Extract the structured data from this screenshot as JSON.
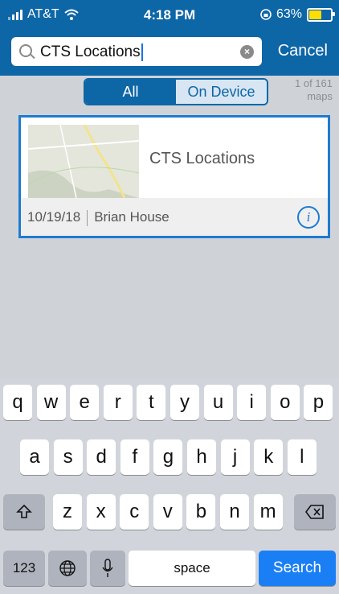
{
  "status": {
    "carrier": "AT&T",
    "time": "4:18 PM",
    "battery": "63%",
    "battery_level": 0.63
  },
  "search": {
    "value": "CTS Locations",
    "cancel": "Cancel"
  },
  "filter": {
    "all": "All",
    "device": "On Device",
    "count_line1": "1 of 161",
    "count_line2": "maps"
  },
  "map": {
    "title": "CTS Locations",
    "date": "10/19/18",
    "owner": "Brian House"
  },
  "keyboard": {
    "row1": [
      "q",
      "w",
      "e",
      "r",
      "t",
      "y",
      "u",
      "i",
      "o",
      "p"
    ],
    "row2": [
      "a",
      "s",
      "d",
      "f",
      "g",
      "h",
      "j",
      "k",
      "l"
    ],
    "row3": [
      "z",
      "x",
      "c",
      "v",
      "b",
      "n",
      "m"
    ],
    "numbers": "123",
    "space": "space",
    "search": "Search"
  }
}
